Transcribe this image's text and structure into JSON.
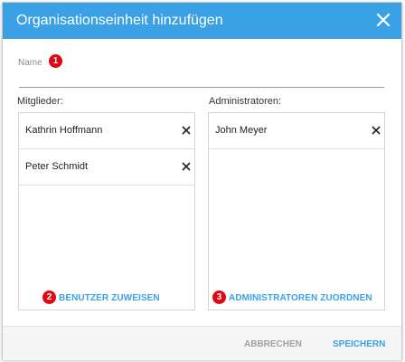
{
  "dialog": {
    "title": "Organisationseinheit hinzufügen",
    "close_icon": "close-icon"
  },
  "name_field": {
    "label": "Name",
    "value": "",
    "badge": "1"
  },
  "members": {
    "label": "Mitglieder:",
    "items": [
      {
        "name": "Kathrin Hoffmann"
      },
      {
        "name": "Peter Schmidt"
      }
    ],
    "assign_label": "BENUTZER ZUWEISEN",
    "badge": "2"
  },
  "admins": {
    "label": "Administratoren:",
    "items": [
      {
        "name": "John Meyer"
      }
    ],
    "assign_label": "ADMINISTRATOREN ZUORDNEN",
    "badge": "3"
  },
  "footer": {
    "cancel_label": "ABBRECHEN",
    "save_label": "SPEICHERN"
  },
  "colors": {
    "accent": "#3aa1e4",
    "badge": "#e30613",
    "cancel_text": "#a0a0a0"
  }
}
